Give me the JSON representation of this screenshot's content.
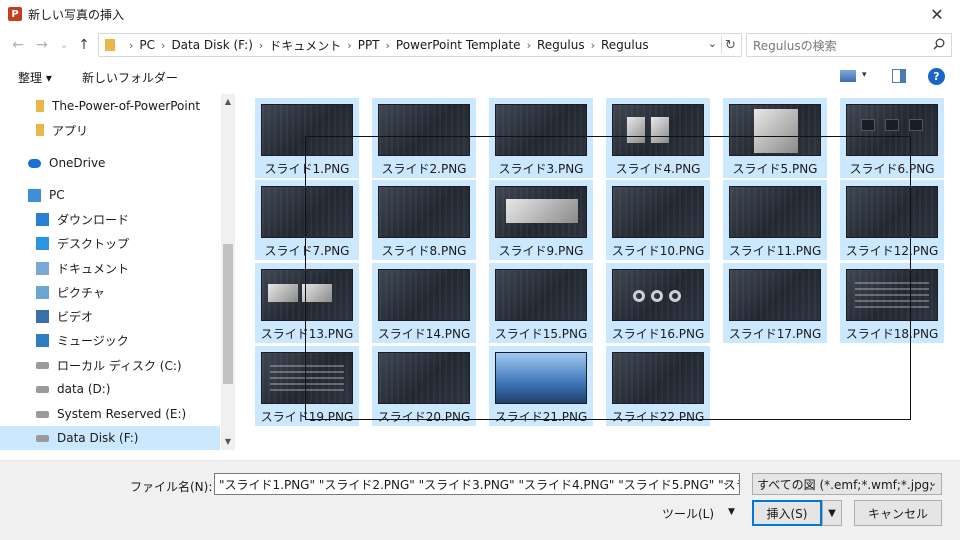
{
  "window": {
    "app_icon_letter": "P",
    "title": "新しい写真の挿入",
    "close": "✕"
  },
  "nav": {
    "back": "←",
    "forward": "→",
    "recent": "⌄",
    "up": "↑",
    "breadcrumb": [
      "PC",
      "Data Disk (F:)",
      "ドキュメント",
      "PPT",
      "PowerPoint Template",
      "Regulus",
      "Regulus"
    ],
    "separator": "›",
    "dropdown": "⌄",
    "refresh": "↻",
    "search_placeholder": "Regulusの検索"
  },
  "toolbar": {
    "organize": "整理 ▾",
    "new_folder": "新しいフォルダー",
    "view_drop": "▾",
    "help": "?"
  },
  "sidebar": {
    "items": [
      {
        "label": "The-Power-of-PowerPoint",
        "icon": "folder-icon"
      },
      {
        "label": "アプリ",
        "icon": "folder-icon"
      },
      {
        "label": "OneDrive",
        "icon": "onedrive-icon"
      },
      {
        "label": "PC",
        "icon": "pc-icon"
      },
      {
        "label": "ダウンロード",
        "icon": "download-icon"
      },
      {
        "label": "デスクトップ",
        "icon": "desktop-icon"
      },
      {
        "label": "ドキュメント",
        "icon": "documents-icon"
      },
      {
        "label": "ピクチャ",
        "icon": "pictures-icon"
      },
      {
        "label": "ビデオ",
        "icon": "video-icon"
      },
      {
        "label": "ミュージック",
        "icon": "music-icon"
      },
      {
        "label": "ローカル ディスク (C:)",
        "icon": "drive-icon"
      },
      {
        "label": "data (D:)",
        "icon": "drive-icon"
      },
      {
        "label": "System Reserved (E:)",
        "icon": "drive-icon"
      },
      {
        "label": "Data Disk (F:)",
        "icon": "drive-icon"
      }
    ],
    "scroll_up": "▲",
    "scroll_down": "▼"
  },
  "files": [
    "スライド1.PNG",
    "スライド2.PNG",
    "スライド3.PNG",
    "スライド4.PNG",
    "スライド5.PNG",
    "スライド6.PNG",
    "スライド7.PNG",
    "スライド8.PNG",
    "スライド9.PNG",
    "スライド10.PNG",
    "スライド11.PNG",
    "スライド12.PNG",
    "スライド13.PNG",
    "スライド14.PNG",
    "スライド15.PNG",
    "スライド16.PNG",
    "スライド17.PNG",
    "スライド18.PNG",
    "スライド19.PNG",
    "スライド20.PNG",
    "スライド21.PNG",
    "スライド22.PNG"
  ],
  "footer": {
    "filename_label": "ファイル名(N):",
    "filename_value": "\"スライド1.PNG\" \"スライド2.PNG\" \"スライド3.PNG\" \"スライド4.PNG\" \"スライド5.PNG\" \"スラ",
    "dropdown": "⌄",
    "filter": "すべての図 (*.emf;*.wmf;*.jpg;",
    "tools": "ツール(L)",
    "tools_drop": "▼",
    "insert": "挿入(S)",
    "insert_drop": "▼",
    "cancel": "キャンセル"
  }
}
